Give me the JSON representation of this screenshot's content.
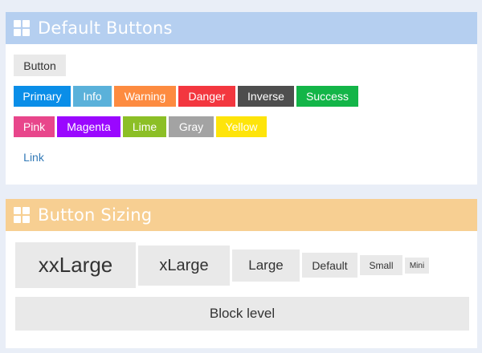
{
  "panels": {
    "default_buttons": {
      "title": "Default Buttons",
      "button": "Button",
      "row1": [
        {
          "label": "Primary",
          "color": "#0a8ee8"
        },
        {
          "label": "Info",
          "color": "#5ab1da"
        },
        {
          "label": "Warning",
          "color": "#fd8b40"
        },
        {
          "label": "Danger",
          "color": "#f3373f"
        },
        {
          "label": "Inverse",
          "color": "#4e4e4e"
        },
        {
          "label": "Success",
          "color": "#13b548"
        }
      ],
      "row2": [
        {
          "label": "Pink",
          "color": "#e8468b"
        },
        {
          "label": "Magenta",
          "color": "#9a07ff"
        },
        {
          "label": "Lime",
          "color": "#8cbf26"
        },
        {
          "label": "Gray",
          "color": "#a3a3a3"
        },
        {
          "label": "Yellow",
          "color": "#fee40a"
        }
      ],
      "link": "Link"
    },
    "button_sizing": {
      "title": "Button Sizing",
      "sizes": [
        "xxLarge",
        "xLarge",
        "Large",
        "Default",
        "Small",
        "Mini"
      ],
      "block": "Block level"
    }
  }
}
